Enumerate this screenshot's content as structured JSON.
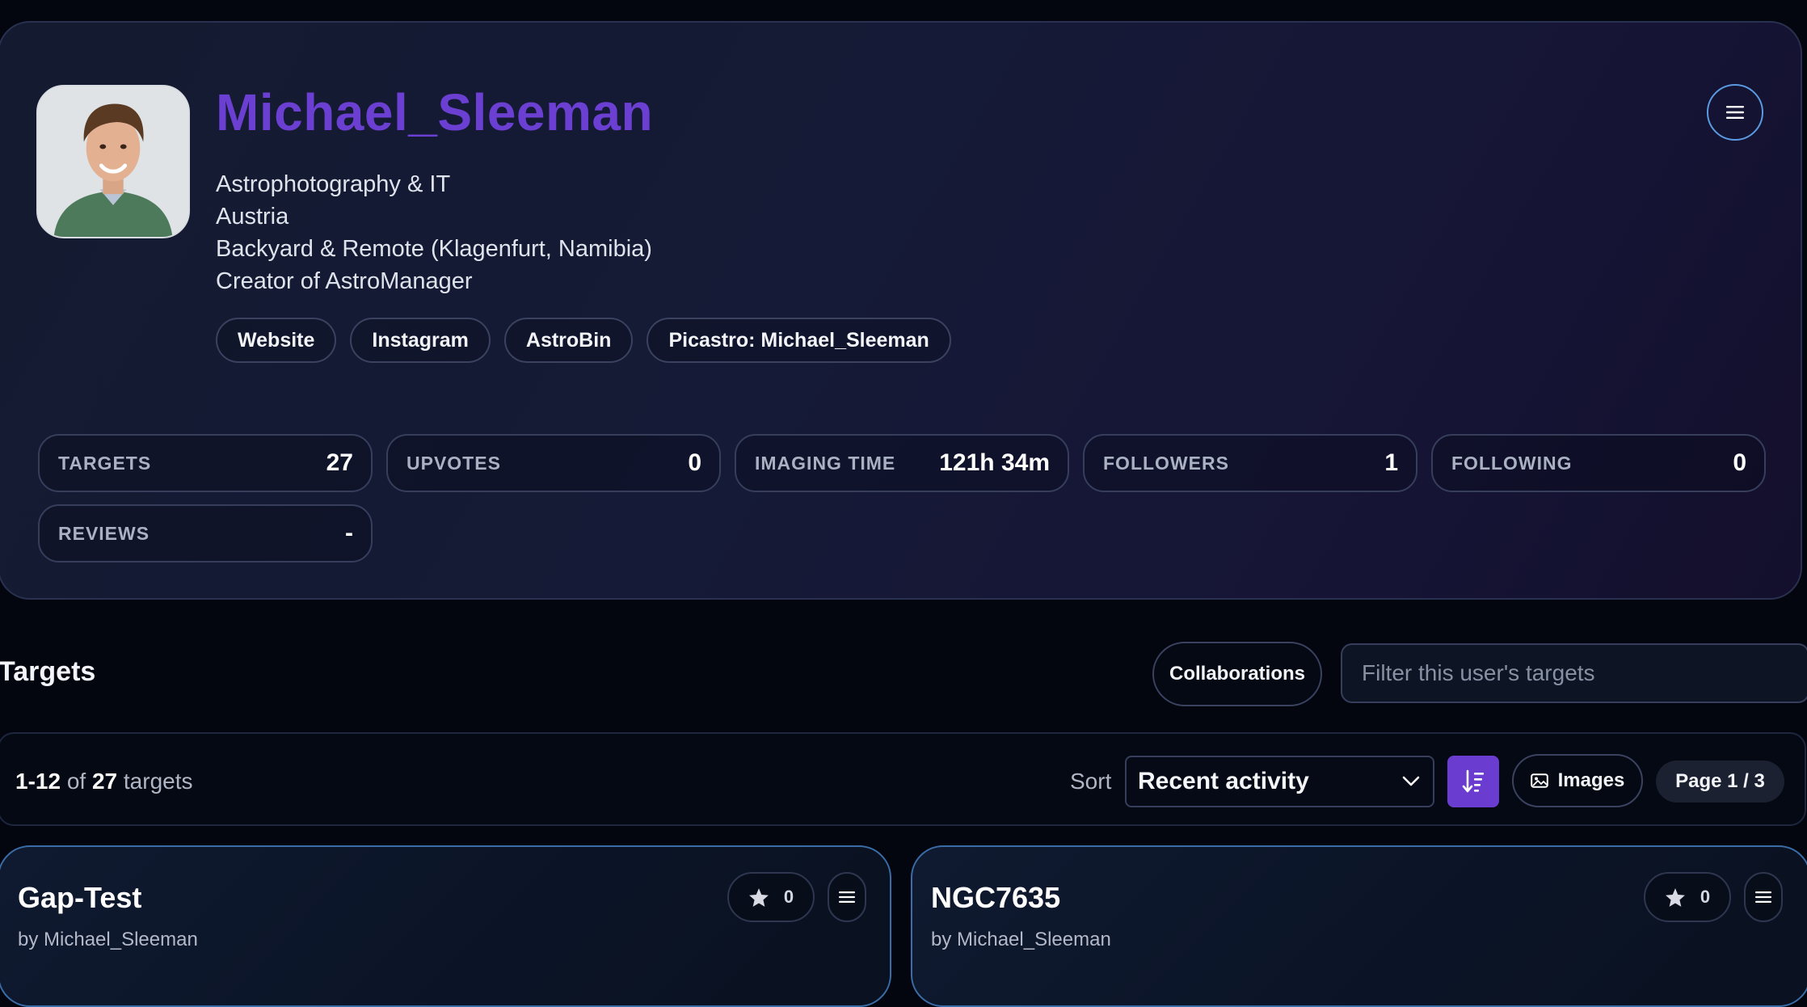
{
  "profile": {
    "username": "Michael_Sleeman",
    "bio_lines": [
      "Astrophotography & IT",
      "Austria",
      "Backyard & Remote (Klagenfurt, Namibia)",
      "Creator of AstroManager"
    ],
    "links": [
      "Website",
      "Instagram",
      "AstroBin",
      "Picastro: Michael_Sleeman"
    ],
    "menu_icon": "hamburger-icon",
    "accent_color": "#6b3fd2"
  },
  "stats": [
    {
      "label": "TARGETS",
      "value": "27"
    },
    {
      "label": "UPVOTES",
      "value": "0"
    },
    {
      "label": "IMAGING TIME",
      "value": "121h 34m"
    },
    {
      "label": "FOLLOWERS",
      "value": "1"
    },
    {
      "label": "FOLLOWING",
      "value": "0"
    },
    {
      "label": "REVIEWS",
      "value": "-"
    }
  ],
  "targets_section": {
    "title": "Targets",
    "collaborations_label": "Collaborations",
    "filter_placeholder": "Filter this user's targets"
  },
  "toolbar": {
    "range": "1-12",
    "of_text": "of",
    "total": "27",
    "unit": "targets",
    "sort_label": "Sort",
    "sort_value": "Recent activity",
    "sort_direction_icon": "sort-descending-icon",
    "images_label": "Images",
    "page_label": "Page 1 / 3"
  },
  "cards": [
    {
      "title": "Gap-Test",
      "author": "by Michael_Sleeman",
      "stars": "0"
    },
    {
      "title": "NGC7635",
      "author": "by Michael_Sleeman",
      "stars": "0"
    }
  ]
}
